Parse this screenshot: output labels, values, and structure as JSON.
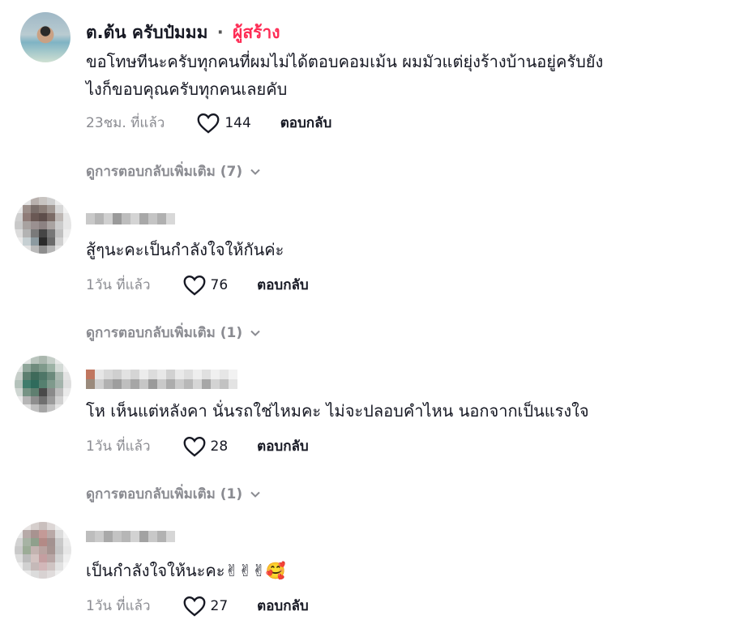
{
  "comments": [
    {
      "author": "ต.ต้น ครับป๋มมม",
      "separator": "·",
      "badge": "ผู้สร้าง",
      "lines": [
        "ขอโทษทีนะครับทุกคนที่ผมไม่ได้ตอบคอมเม้น ผมมัวแต่ยุ่งร้างบ้านอยู่ครับยัง",
        "ไงก็ขอบคุณครับทุกคนเลยคับ"
      ],
      "time": "23ชม. ที่แล้ว",
      "likes": "144",
      "reply_label": "ตอบกลับ",
      "more_replies": "ดูการตอบกลับเพิ่มเติม (7)"
    },
    {
      "lines": [
        "สู้ๆนะคะเป็นกำลังใจให้กันค่ะ"
      ],
      "time": "1วัน ที่แล้ว",
      "likes": "76",
      "reply_label": "ตอบกลับ",
      "more_replies": "ดูการตอบกลับเพิ่มเติม (1)"
    },
    {
      "lines": [
        "โห เห็นแต่หลังคา นั่นรถใช่ไหมคะ ไม่จะปลอบคำไหน นอกจากเป็นแรงใจ"
      ],
      "time": "1วัน ที่แล้ว",
      "likes": "28",
      "reply_label": "ตอบกลับ",
      "more_replies": "ดูการตอบกลับเพิ่มเติม (1)"
    },
    {
      "lines": [
        "เป็นกำลังใจให้นะคะ✌✌✌🥰"
      ],
      "time": "1วัน ที่แล้ว",
      "likes": "27",
      "reply_label": "ตอบกลับ"
    }
  ],
  "icons": {
    "like": "heart-outline-icon",
    "expand": "chevron-down-icon"
  }
}
